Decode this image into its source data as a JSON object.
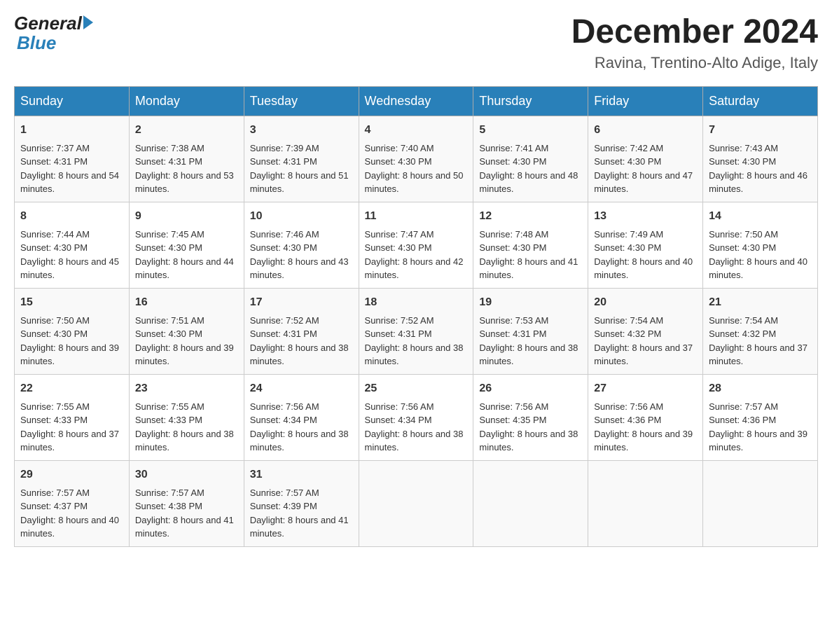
{
  "header": {
    "logo_general": "General",
    "logo_blue": "Blue",
    "month_year": "December 2024",
    "location": "Ravina, Trentino-Alto Adige, Italy"
  },
  "weekdays": [
    "Sunday",
    "Monday",
    "Tuesday",
    "Wednesday",
    "Thursday",
    "Friday",
    "Saturday"
  ],
  "weeks": [
    [
      {
        "day": "1",
        "sunrise": "7:37 AM",
        "sunset": "4:31 PM",
        "daylight": "8 hours and 54 minutes."
      },
      {
        "day": "2",
        "sunrise": "7:38 AM",
        "sunset": "4:31 PM",
        "daylight": "8 hours and 53 minutes."
      },
      {
        "day": "3",
        "sunrise": "7:39 AM",
        "sunset": "4:31 PM",
        "daylight": "8 hours and 51 minutes."
      },
      {
        "day": "4",
        "sunrise": "7:40 AM",
        "sunset": "4:30 PM",
        "daylight": "8 hours and 50 minutes."
      },
      {
        "day": "5",
        "sunrise": "7:41 AM",
        "sunset": "4:30 PM",
        "daylight": "8 hours and 48 minutes."
      },
      {
        "day": "6",
        "sunrise": "7:42 AM",
        "sunset": "4:30 PM",
        "daylight": "8 hours and 47 minutes."
      },
      {
        "day": "7",
        "sunrise": "7:43 AM",
        "sunset": "4:30 PM",
        "daylight": "8 hours and 46 minutes."
      }
    ],
    [
      {
        "day": "8",
        "sunrise": "7:44 AM",
        "sunset": "4:30 PM",
        "daylight": "8 hours and 45 minutes."
      },
      {
        "day": "9",
        "sunrise": "7:45 AM",
        "sunset": "4:30 PM",
        "daylight": "8 hours and 44 minutes."
      },
      {
        "day": "10",
        "sunrise": "7:46 AM",
        "sunset": "4:30 PM",
        "daylight": "8 hours and 43 minutes."
      },
      {
        "day": "11",
        "sunrise": "7:47 AM",
        "sunset": "4:30 PM",
        "daylight": "8 hours and 42 minutes."
      },
      {
        "day": "12",
        "sunrise": "7:48 AM",
        "sunset": "4:30 PM",
        "daylight": "8 hours and 41 minutes."
      },
      {
        "day": "13",
        "sunrise": "7:49 AM",
        "sunset": "4:30 PM",
        "daylight": "8 hours and 40 minutes."
      },
      {
        "day": "14",
        "sunrise": "7:50 AM",
        "sunset": "4:30 PM",
        "daylight": "8 hours and 40 minutes."
      }
    ],
    [
      {
        "day": "15",
        "sunrise": "7:50 AM",
        "sunset": "4:30 PM",
        "daylight": "8 hours and 39 minutes."
      },
      {
        "day": "16",
        "sunrise": "7:51 AM",
        "sunset": "4:30 PM",
        "daylight": "8 hours and 39 minutes."
      },
      {
        "day": "17",
        "sunrise": "7:52 AM",
        "sunset": "4:31 PM",
        "daylight": "8 hours and 38 minutes."
      },
      {
        "day": "18",
        "sunrise": "7:52 AM",
        "sunset": "4:31 PM",
        "daylight": "8 hours and 38 minutes."
      },
      {
        "day": "19",
        "sunrise": "7:53 AM",
        "sunset": "4:31 PM",
        "daylight": "8 hours and 38 minutes."
      },
      {
        "day": "20",
        "sunrise": "7:54 AM",
        "sunset": "4:32 PM",
        "daylight": "8 hours and 37 minutes."
      },
      {
        "day": "21",
        "sunrise": "7:54 AM",
        "sunset": "4:32 PM",
        "daylight": "8 hours and 37 minutes."
      }
    ],
    [
      {
        "day": "22",
        "sunrise": "7:55 AM",
        "sunset": "4:33 PM",
        "daylight": "8 hours and 37 minutes."
      },
      {
        "day": "23",
        "sunrise": "7:55 AM",
        "sunset": "4:33 PM",
        "daylight": "8 hours and 38 minutes."
      },
      {
        "day": "24",
        "sunrise": "7:56 AM",
        "sunset": "4:34 PM",
        "daylight": "8 hours and 38 minutes."
      },
      {
        "day": "25",
        "sunrise": "7:56 AM",
        "sunset": "4:34 PM",
        "daylight": "8 hours and 38 minutes."
      },
      {
        "day": "26",
        "sunrise": "7:56 AM",
        "sunset": "4:35 PM",
        "daylight": "8 hours and 38 minutes."
      },
      {
        "day": "27",
        "sunrise": "7:56 AM",
        "sunset": "4:36 PM",
        "daylight": "8 hours and 39 minutes."
      },
      {
        "day": "28",
        "sunrise": "7:57 AM",
        "sunset": "4:36 PM",
        "daylight": "8 hours and 39 minutes."
      }
    ],
    [
      {
        "day": "29",
        "sunrise": "7:57 AM",
        "sunset": "4:37 PM",
        "daylight": "8 hours and 40 minutes."
      },
      {
        "day": "30",
        "sunrise": "7:57 AM",
        "sunset": "4:38 PM",
        "daylight": "8 hours and 41 minutes."
      },
      {
        "day": "31",
        "sunrise": "7:57 AM",
        "sunset": "4:39 PM",
        "daylight": "8 hours and 41 minutes."
      },
      null,
      null,
      null,
      null
    ]
  ],
  "labels": {
    "sunrise": "Sunrise:",
    "sunset": "Sunset:",
    "daylight": "Daylight:"
  }
}
